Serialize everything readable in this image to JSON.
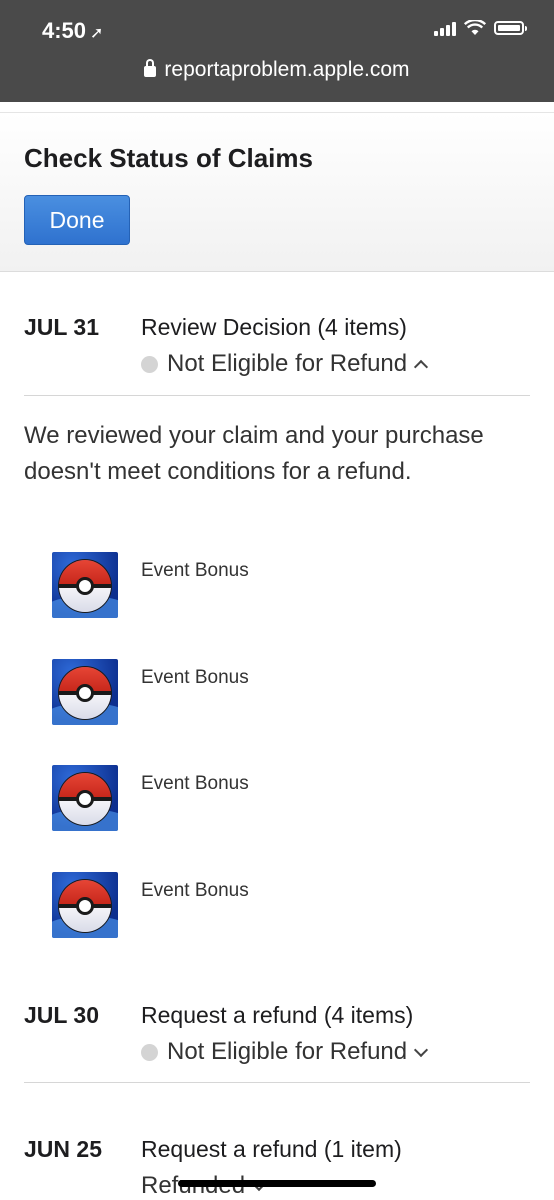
{
  "status_bar": {
    "time": "4:50",
    "location_arrow": "location-arrow-icon"
  },
  "browser": {
    "url": "reportaproblem.apple.com"
  },
  "header": {
    "title": "Check Status of Claims",
    "done_label": "Done"
  },
  "claims": [
    {
      "date": "JUL 31",
      "title": "Review Decision (4 items)",
      "status": "Not Eligible for Refund",
      "expanded": true,
      "message": "We reviewed your claim and your purchase doesn't meet conditions for a refund.",
      "items": [
        {
          "name": "Event Bonus",
          "icon": "pokeball-app-icon"
        },
        {
          "name": "Event Bonus",
          "icon": "pokeball-app-icon"
        },
        {
          "name": "Event Bonus",
          "icon": "pokeball-app-icon"
        },
        {
          "name": "Event Bonus",
          "icon": "pokeball-app-icon"
        }
      ]
    },
    {
      "date": "JUL 30",
      "title": "Request a refund (4 items)",
      "status": "Not Eligible for Refund",
      "expanded": false
    },
    {
      "date": "JUN 25",
      "title": "Request a refund (1 item)",
      "status": "Refunded",
      "expanded": false
    }
  ],
  "colors": {
    "accent": "#2f72cf",
    "status_dot": "#d4d4d4",
    "browser_bar": "#4a4a4a"
  }
}
